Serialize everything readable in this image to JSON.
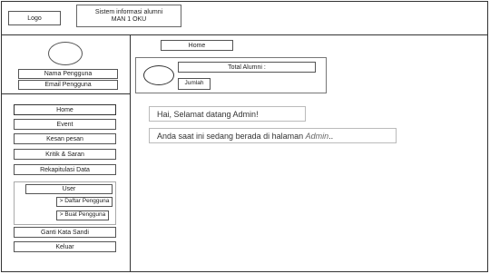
{
  "header": {
    "logo_label": "Logo",
    "title_line1": "Sistem informasi alumni",
    "title_line2": "MAN 1 OKU"
  },
  "profile": {
    "name_label": "Nama Pengguna",
    "email_label": "Email Pengguna"
  },
  "sidebar": {
    "items": [
      "Home",
      "Event",
      "Kesan pesan",
      "Kritik & Saran",
      "Rekapitulasi Data"
    ],
    "user_group": {
      "label": "User",
      "subitems": [
        "> Daftar Pengguna",
        "> Buat Pengguna"
      ]
    },
    "bottom_items": [
      "Ganti Kata Sandi",
      "Keluar"
    ]
  },
  "main": {
    "breadcrumb": "Home",
    "stat_card": {
      "title": "Total Alumni :",
      "value_label": "Jumlah"
    },
    "greeting": "Hai, Selamat datang Admin!",
    "info_prefix": "Anda saat ini sedang berada di halaman ",
    "info_page": "Admin",
    "info_suffix": ".."
  }
}
